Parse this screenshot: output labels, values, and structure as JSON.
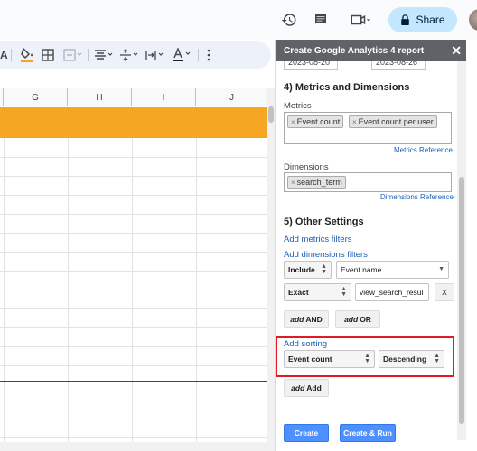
{
  "topbar": {
    "share_label": "Share",
    "icons": [
      "history-icon",
      "comment-icon",
      "video-call-icon",
      "lock-icon"
    ]
  },
  "toolbar": {
    "font_partial": "A",
    "icons": [
      "fill-color-icon",
      "borders-icon",
      "merge-cells-icon",
      "horizontal-align-icon",
      "vertical-align-icon",
      "text-rotation-icon",
      "text-color-icon",
      "more-icon"
    ]
  },
  "sheet": {
    "columns": [
      "G",
      "H",
      "I",
      "J"
    ],
    "band_color": "#f5a623"
  },
  "panel": {
    "title": "Create Google Analytics 4 report",
    "dates": [
      "2023-08-20",
      "2023-08-26"
    ],
    "metrics_section": "4) Metrics and Dimensions",
    "metrics_label": "Metrics",
    "metrics": [
      "Event count",
      "Event count per user"
    ],
    "metrics_reference": "Metrics Reference",
    "dimensions_label": "Dimensions",
    "dimensions": [
      "search_term"
    ],
    "dimensions_reference": "Dimensions Reference",
    "other_section": "5) Other Settings",
    "add_metrics_filters": "Add metrics filters",
    "add_dimensions_filters": "Add dimensions filters",
    "filter": {
      "include": "Include",
      "dimension": "Event name",
      "match": "Exact",
      "value": "view_search_resul",
      "remove": "X"
    },
    "add_and": "AND",
    "add_or": "OR",
    "add_word": "add",
    "add_sorting": "Add sorting",
    "sort_field": "Event count",
    "sort_order": "Descending",
    "add_add": "Add",
    "create": "Create",
    "create_run": "Create & Run"
  },
  "colors": {
    "highlight": "#e01b24",
    "primary_button": "#4d90fe",
    "share_button": "#c2e7ff"
  }
}
